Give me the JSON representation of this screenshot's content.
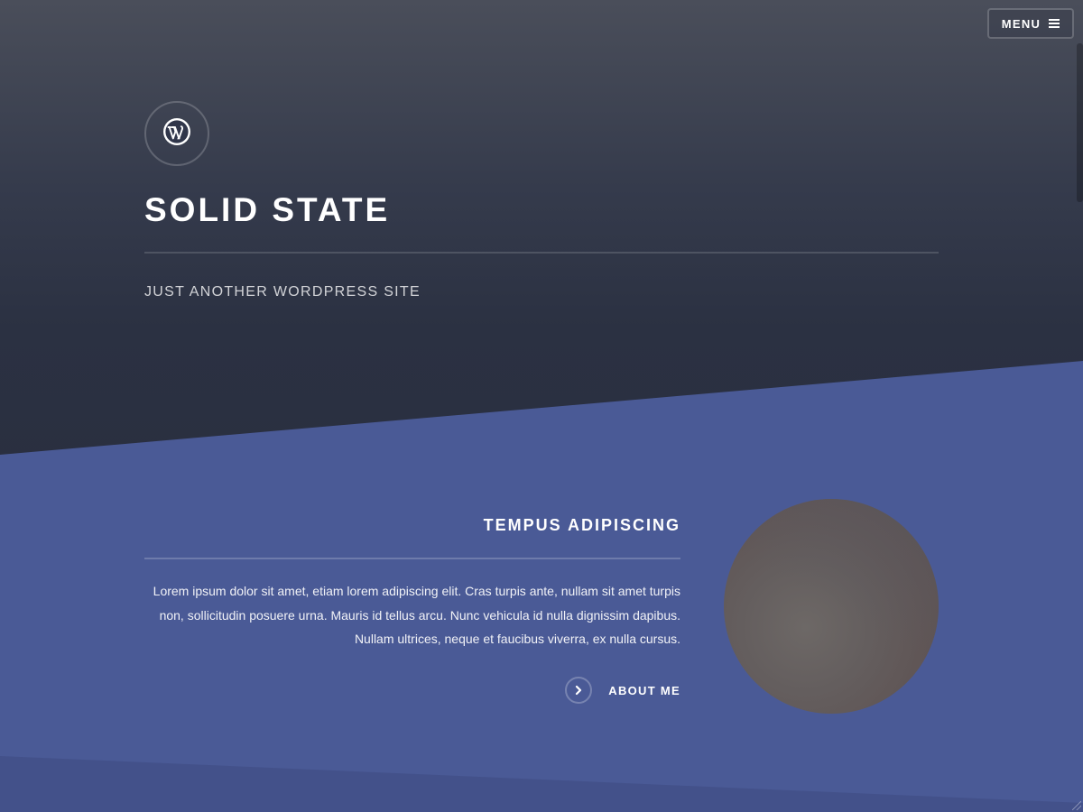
{
  "header": {
    "menu_label": "MENU",
    "menu_icon": "hamburger-icon"
  },
  "banner": {
    "logo_icon": "wordpress-logo-icon",
    "title": "SOLID STATE",
    "tagline": "JUST ANOTHER WORDPRESS SITE"
  },
  "feature": {
    "title": "TEMPUS ADIPISCING",
    "text": "Lorem ipsum dolor sit amet, etiam lorem adipiscing elit. Cras turpis ante, nullam sit amet turpis non, sollicitudin posuere urna. Mauris id tellus arcu. Nunc vehicula id nulla dignissim dapibus. Nullam ultrices, neque et faucibus viverra, ex nulla cursus.",
    "link_label": "ABOUT ME",
    "link_icon": "chevron-right-icon"
  },
  "colors": {
    "hero_bg": "#2c3142",
    "band_bg": "#4a5a96",
    "text": "#ffffff"
  }
}
